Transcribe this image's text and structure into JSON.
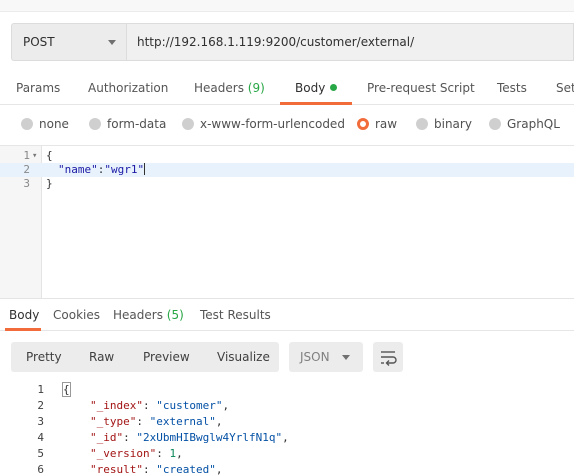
{
  "request": {
    "method": "POST",
    "url": "http://192.168.1.119:9200/customer/external/"
  },
  "request_tabs": [
    {
      "label": "Params"
    },
    {
      "label": "Authorization"
    },
    {
      "label": "Headers",
      "count": "(9)"
    },
    {
      "label": "Body"
    },
    {
      "label": "Pre-request Script"
    },
    {
      "label": "Tests"
    },
    {
      "label": "Set"
    }
  ],
  "body_types": [
    {
      "label": "none"
    },
    {
      "label": "form-data"
    },
    {
      "label": "x-www-form-urlencoded"
    },
    {
      "label": "raw",
      "selected": true
    },
    {
      "label": "binary"
    },
    {
      "label": "GraphQL"
    }
  ],
  "editor": {
    "lines": [
      {
        "n": "1",
        "text": "{"
      },
      {
        "n": "2",
        "key": "\"name\"",
        "sep": ":",
        "value": "\"wgr1\""
      },
      {
        "n": "3",
        "text": "}"
      }
    ]
  },
  "response_tabs": [
    {
      "label": "Body"
    },
    {
      "label": "Cookies"
    },
    {
      "label": "Headers",
      "count": "(5)"
    },
    {
      "label": "Test Results"
    }
  ],
  "view_modes": {
    "pretty": "Pretty",
    "raw": "Raw",
    "preview": "Preview",
    "visualize": "Visualize"
  },
  "format": "JSON",
  "response": {
    "lines": [
      {
        "n": "1",
        "text": "{"
      },
      {
        "n": "2",
        "key": "\"_index\"",
        "value": "\"customer\"",
        "tail": ","
      },
      {
        "n": "3",
        "key": "\"_type\"",
        "value": "\"external\"",
        "tail": ","
      },
      {
        "n": "4",
        "key": "\"_id\"",
        "value": "\"2xUbmHIBwglw4YrlfN1q\"",
        "tail": ","
      },
      {
        "n": "5",
        "key": "\"_version\"",
        "value": "1",
        "tail": ","
      },
      {
        "n": "6",
        "key": "\"result\"",
        "value": "\"created\"",
        "tail": ","
      }
    ]
  },
  "colors": {
    "accent": "#f26b3a",
    "count_green": "#28a745"
  }
}
